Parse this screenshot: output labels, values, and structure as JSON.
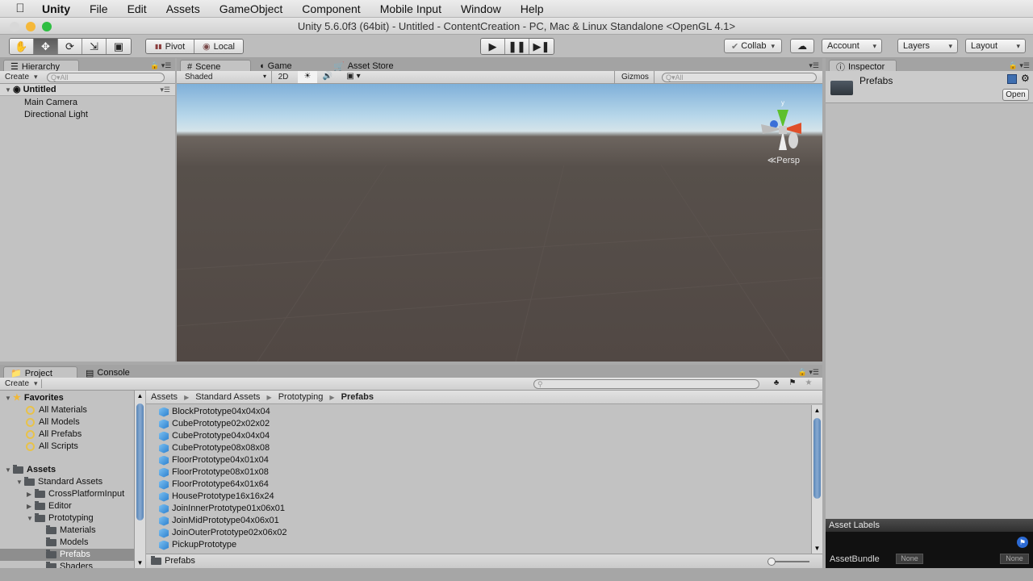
{
  "menubar": {
    "apple_icon": "apple-icon",
    "app": "Unity",
    "items": [
      "File",
      "Edit",
      "Assets",
      "GameObject",
      "Component",
      "Mobile Input",
      "Window",
      "Help"
    ]
  },
  "window": {
    "title": "Unity 5.6.0f3 (64bit) - Untitled - ContentCreation - PC, Mac & Linux Standalone <OpenGL 4.1>"
  },
  "toolbar": {
    "tools": [
      "hand-tool",
      "move-tool",
      "rotate-tool",
      "scale-tool",
      "rect-tool"
    ],
    "active_tool": "move-tool",
    "pivot": "Pivot",
    "local": "Local",
    "collab": "Collab",
    "account": "Account",
    "layers": "Layers",
    "layout": "Layout"
  },
  "hierarchy": {
    "tab": "Hierarchy",
    "create": "Create",
    "search_placeholder": "Q▾All",
    "scene_name": "Untitled",
    "items": [
      "Main Camera",
      "Directional Light"
    ]
  },
  "scene_view": {
    "tabs": [
      "Scene",
      "Game",
      "Asset Store"
    ],
    "active_tab": "Scene",
    "shading": "Shaded",
    "mode_2d": "2D",
    "gizmos": "Gizmos",
    "search_placeholder": "Q▾All",
    "projection": "Persp",
    "axes": {
      "x": "x",
      "y": "y",
      "z": "z"
    }
  },
  "inspector": {
    "tab": "Inspector",
    "name": "Prefabs",
    "open": "Open",
    "asset_labels": "Asset Labels",
    "assetbundle_label": "AssetBundle",
    "assetbundle_value": "None",
    "assetbundle_variant": "None"
  },
  "project": {
    "tabs": [
      "Project",
      "Console"
    ],
    "active_tab": "Project",
    "create": "Create",
    "breadcrumb": [
      "Assets",
      "Standard Assets",
      "Prototyping",
      "Prefabs"
    ],
    "favorites": {
      "label": "Favorites",
      "items": [
        "All Materials",
        "All Models",
        "All Prefabs",
        "All Scripts"
      ]
    },
    "tree": [
      {
        "label": "Assets",
        "depth": 0,
        "expanded": true
      },
      {
        "label": "Standard Assets",
        "depth": 1,
        "expanded": true
      },
      {
        "label": "CrossPlatformInput",
        "depth": 2,
        "expanded": false
      },
      {
        "label": "Editor",
        "depth": 2,
        "expanded": false
      },
      {
        "label": "Prototyping",
        "depth": 2,
        "expanded": true
      },
      {
        "label": "Materials",
        "depth": 3
      },
      {
        "label": "Models",
        "depth": 3
      },
      {
        "label": "Prefabs",
        "depth": 3,
        "selected": true
      },
      {
        "label": "Shaders",
        "depth": 3
      }
    ],
    "assets": [
      "BlockPrototype04x04x04",
      "CubePrototype02x02x02",
      "CubePrototype04x04x04",
      "CubePrototype08x08x08",
      "FloorPrototype04x01x04",
      "FloorPrototype08x01x08",
      "FloorPrototype64x01x64",
      "HousePrototype16x16x24",
      "JoinInnerPrototype01x06x01",
      "JoinMidPrototype04x06x01",
      "JoinOuterPrototype02x06x02",
      "PickupPrototype"
    ],
    "status_path": "Prefabs"
  }
}
